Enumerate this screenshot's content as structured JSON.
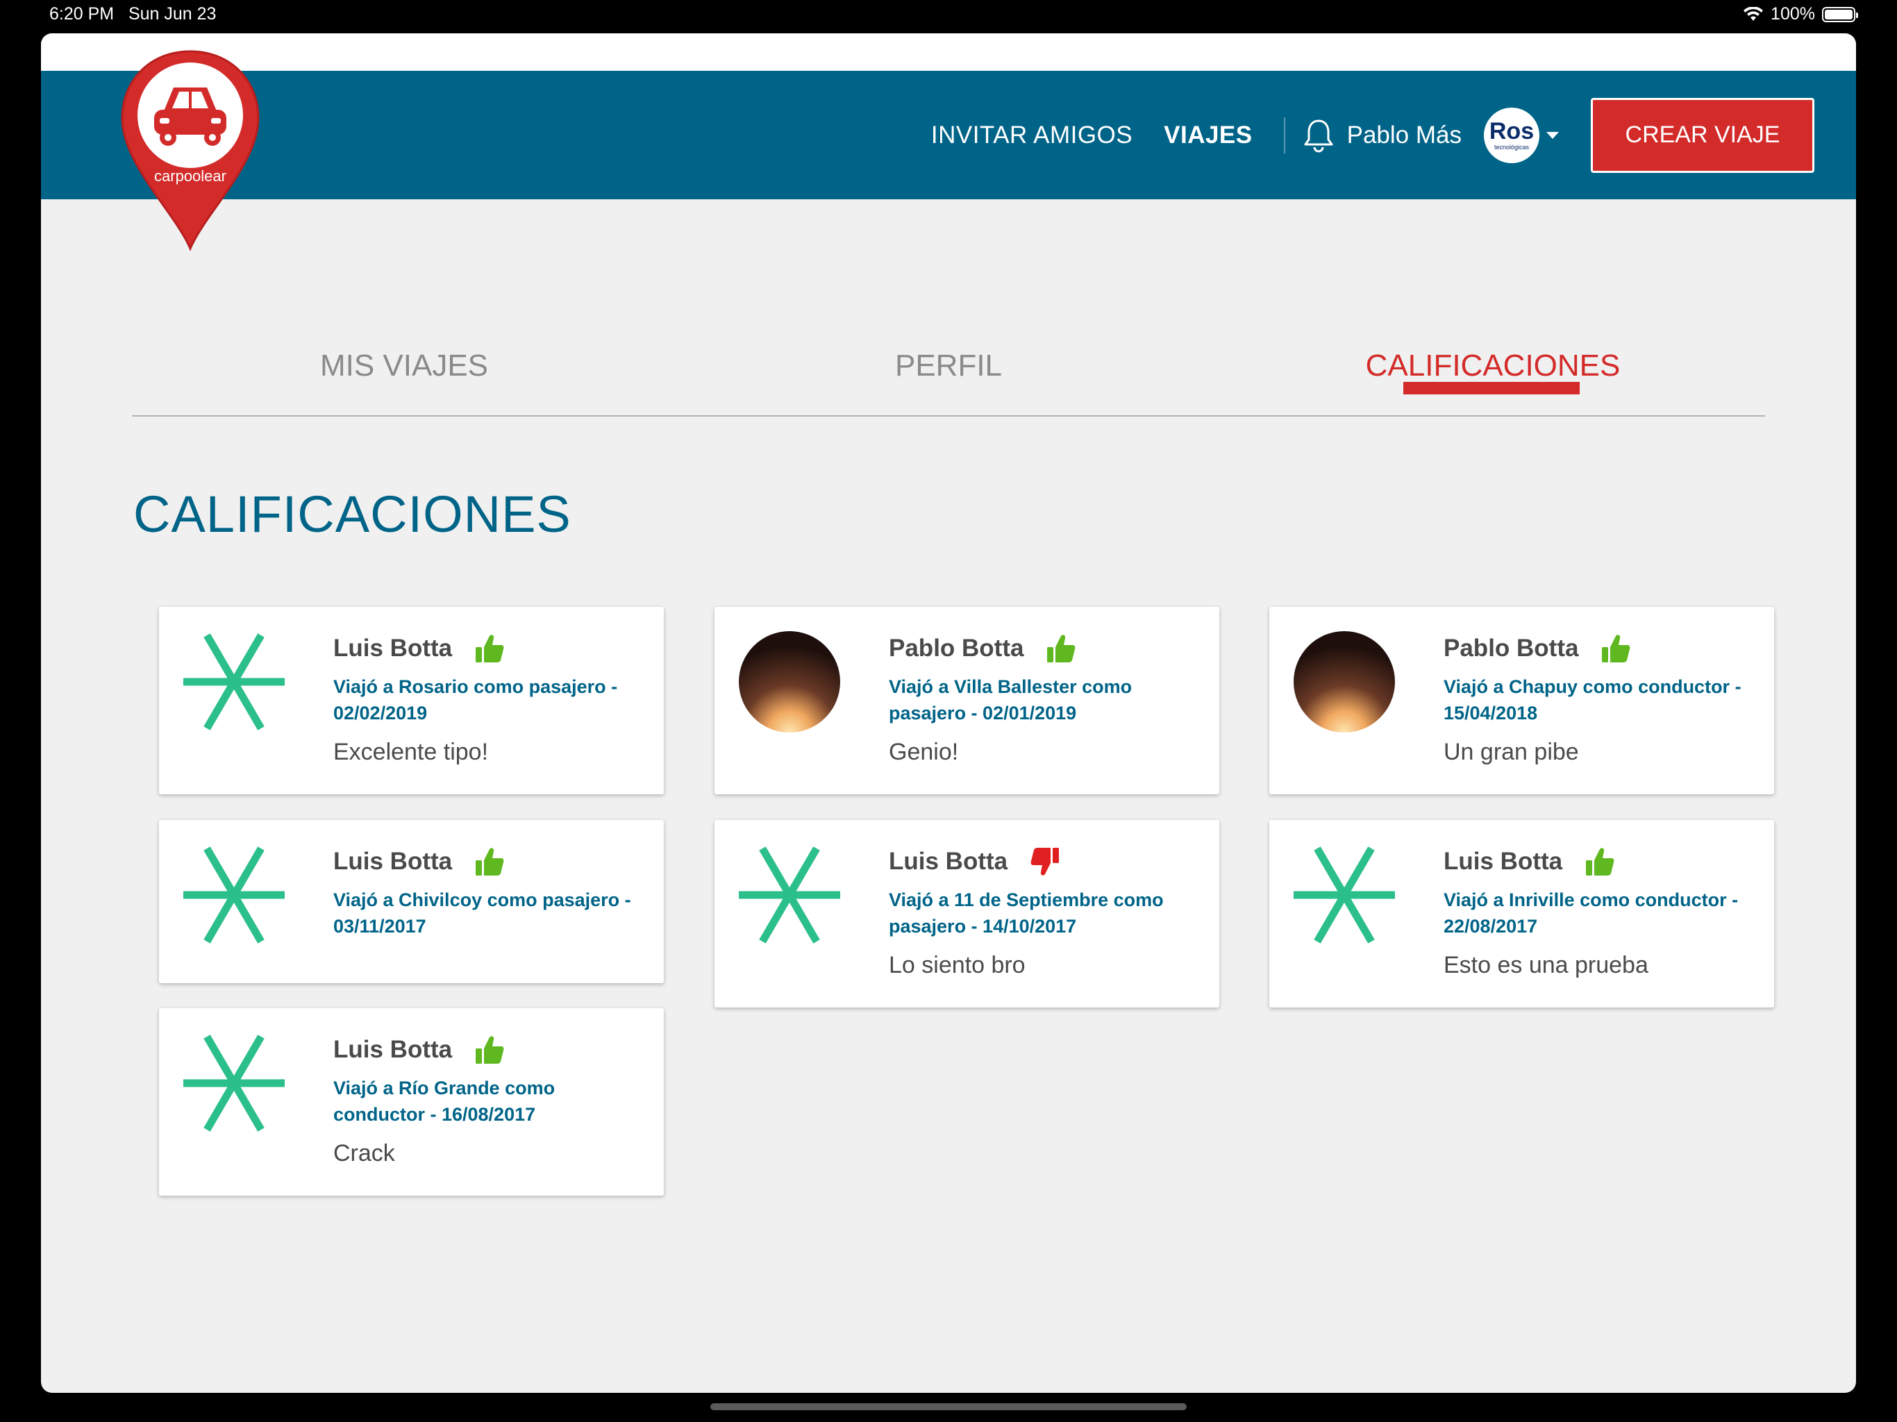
{
  "status_bar": {
    "time": "6:20 PM",
    "date": "Sun Jun 23",
    "battery": "100%"
  },
  "nav": {
    "logo_text": "carpoolear",
    "invite": "INVITAR AMIGOS",
    "trips": "VIAJES",
    "user_name": "Pablo Más",
    "avatar_text": "Ros",
    "avatar_subtext": "tecnológicas",
    "create_button": "CREAR VIAJE"
  },
  "tabs": [
    {
      "label": "MIS VIAJES"
    },
    {
      "label": "PERFIL"
    },
    {
      "label": "CALIFICACIONES"
    }
  ],
  "section_title": "CALIFICACIONES",
  "colors": {
    "brand_blue": "#006488",
    "accent_red": "#d32b29",
    "thumb_up": "#5fb820",
    "thumb_down": "#e02020",
    "avatar_green": "#2bbf8a"
  },
  "ratings": [
    {
      "name": "Luis Botta",
      "positive": true,
      "avatar": "asterisk",
      "trip": "Viajó a Rosario como pasajero - 02/02/2019",
      "comment": "Excelente tipo!"
    },
    {
      "name": "Pablo Botta",
      "positive": true,
      "avatar": "photo",
      "trip": "Viajó a Villa Ballester como pasajero - 02/01/2019",
      "comment": "Genio!"
    },
    {
      "name": "Pablo Botta",
      "positive": true,
      "avatar": "photo",
      "trip": "Viajó a Chapuy como conductor - 15/04/2018",
      "comment": "Un gran pibe"
    },
    {
      "name": "Luis Botta",
      "positive": true,
      "avatar": "asterisk",
      "trip": "Viajó a Chivilcoy como pasajero - 03/11/2017",
      "comment": ""
    },
    {
      "name": "Luis Botta",
      "positive": false,
      "avatar": "asterisk",
      "trip": "Viajó a 11 de Septiembre como pasajero - 14/10/2017",
      "comment": "Lo siento bro"
    },
    {
      "name": "Luis Botta",
      "positive": true,
      "avatar": "asterisk",
      "trip": "Viajó a Inriville como conductor - 22/08/2017",
      "comment": "Esto es una prueba"
    },
    {
      "name": "Luis Botta",
      "positive": true,
      "avatar": "asterisk",
      "trip": "Viajó a Río Grande como conductor - 16/08/2017",
      "comment": "Crack"
    }
  ]
}
